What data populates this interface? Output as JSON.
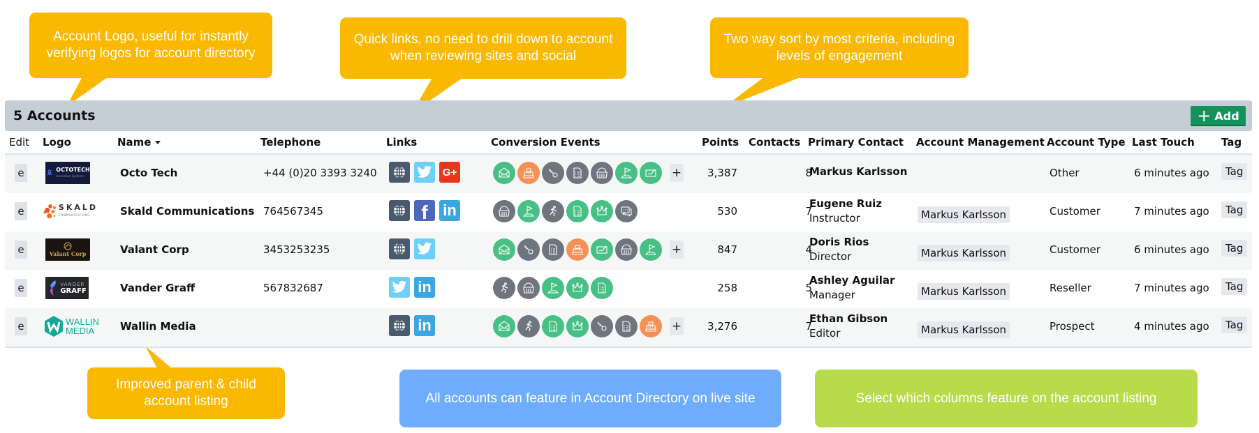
{
  "callouts": {
    "logo": "Account Logo, useful for instantly verifying logos for account directory",
    "links": "Quick links, no need to drill down to account when reviewing sites and social",
    "sort": "Two way sort by most criteria, including levels of engagement",
    "parent_child": "Improved parent & child account listing",
    "directory": "All accounts can feature in Account Directory on live site",
    "columns": "Select which columns feature on the account listing"
  },
  "colors": {
    "callout_yellow": "#fbb800",
    "callout_blue": "#6fadfc",
    "callout_green": "#b8db4a",
    "add_button": "#13935a",
    "event_green": "#47bf85",
    "event_grey": "#6f757e",
    "event_orange": "#f59057"
  },
  "list": {
    "title": "5 Accounts",
    "add_label": "Add"
  },
  "columns": {
    "edit": "Edit",
    "logo": "Logo",
    "name": "Name",
    "telephone": "Telephone",
    "links": "Links",
    "conversion_events": "Conversion Events",
    "points": "Points",
    "contacts": "Contacts",
    "primary_contact": "Primary Contact",
    "account_management": "Account Management",
    "account_type": "Account Type",
    "last_touch": "Last Touch",
    "tag": "Tag"
  },
  "sort": {
    "column": "Name",
    "direction": "descending-caret"
  },
  "rows": [
    {
      "edit_label": "e",
      "logo": "octotech-logo",
      "logo_text": "OCTOTECH",
      "logo_subtext": "Innovation Systems",
      "name": "Octo Tech",
      "telephone": "+44 (0)20 3393 3240",
      "links": [
        "globe-icon",
        "twitter-icon",
        "google-plus-icon"
      ],
      "events": [
        {
          "icon": "envelope-open-icon",
          "color": "green"
        },
        {
          "icon": "cash-register-icon",
          "color": "orange"
        },
        {
          "icon": "key-icon",
          "color": "grey"
        },
        {
          "icon": "document-checklist-icon",
          "color": "grey"
        },
        {
          "icon": "basket-icon",
          "color": "grey"
        },
        {
          "icon": "flag-icon",
          "color": "green"
        },
        {
          "icon": "signature-icon",
          "color": "green"
        }
      ],
      "has_more_events": true,
      "points": "3,387",
      "contacts": "8",
      "primary_contact": {
        "name": "Markus Karlsson",
        "title": ""
      },
      "account_manager": "",
      "account_type": "Other",
      "last_touch": "6 minutes ago",
      "tag_label": "Tag"
    },
    {
      "edit_label": "e",
      "logo": "skald-logo",
      "logo_text": "SKALD",
      "logo_subtext": "COMMUNICATIONS",
      "name": "Skald Communications",
      "telephone": "764567345",
      "links": [
        "globe-icon",
        "facebook-icon",
        "linkedin-icon"
      ],
      "events": [
        {
          "icon": "basket-icon",
          "color": "grey"
        },
        {
          "icon": "flag-icon",
          "color": "green"
        },
        {
          "icon": "running-person-icon",
          "color": "grey"
        },
        {
          "icon": "document-checklist-icon",
          "color": "green"
        },
        {
          "icon": "crown-icon",
          "color": "green"
        },
        {
          "icon": "chat-bubbles-icon",
          "color": "grey"
        }
      ],
      "has_more_events": false,
      "points": "530",
      "contacts": "7",
      "primary_contact": {
        "name": "Eugene Ruiz",
        "title": "Instructor"
      },
      "account_manager": "Markus Karlsson",
      "account_type": "Customer",
      "last_touch": "7 minutes ago",
      "tag_label": "Tag"
    },
    {
      "edit_label": "e",
      "logo": "valant-logo",
      "logo_text": "Valant Corp",
      "logo_subtext": "",
      "name": "Valant Corp",
      "telephone": "3453253235",
      "links": [
        "globe-icon",
        "twitter-icon"
      ],
      "events": [
        {
          "icon": "envelope-open-icon",
          "color": "green"
        },
        {
          "icon": "key-icon",
          "color": "grey"
        },
        {
          "icon": "document-checklist-icon",
          "color": "grey"
        },
        {
          "icon": "cash-register-icon",
          "color": "orange"
        },
        {
          "icon": "signature-icon",
          "color": "green"
        },
        {
          "icon": "basket-icon",
          "color": "grey"
        },
        {
          "icon": "flag-icon",
          "color": "green"
        }
      ],
      "has_more_events": true,
      "points": "847",
      "contacts": "4",
      "primary_contact": {
        "name": "Doris Rios",
        "title": "Director"
      },
      "account_manager": "Markus Karlsson",
      "account_type": "Customer",
      "last_touch": "6 minutes ago",
      "tag_label": "Tag"
    },
    {
      "edit_label": "e",
      "logo": "vander-graff-logo",
      "logo_text": "GRAFF",
      "logo_subtext": "VANDER",
      "name": "Vander Graff",
      "telephone": "567832687",
      "links": [
        "twitter-icon",
        "linkedin-icon"
      ],
      "events": [
        {
          "icon": "running-person-icon",
          "color": "grey"
        },
        {
          "icon": "basket-icon",
          "color": "grey"
        },
        {
          "icon": "flag-icon",
          "color": "green"
        },
        {
          "icon": "crown-icon",
          "color": "green"
        },
        {
          "icon": "document-checklist-icon",
          "color": "green"
        }
      ],
      "has_more_events": false,
      "points": "258",
      "contacts": "5",
      "primary_contact": {
        "name": "Ashley Aguilar",
        "title": "Manager"
      },
      "account_manager": "Markus Karlsson",
      "account_type": "Reseller",
      "last_touch": "7 minutes ago",
      "tag_label": "Tag"
    },
    {
      "edit_label": "e",
      "logo": "wallin-media-logo",
      "logo_text": "WALLIN",
      "logo_subtext": "MEDIA",
      "name": "Wallin Media",
      "telephone": "",
      "links": [
        "globe-icon",
        "linkedin-icon"
      ],
      "events": [
        {
          "icon": "envelope-open-icon",
          "color": "green"
        },
        {
          "icon": "running-person-icon",
          "color": "grey"
        },
        {
          "icon": "document-checklist-icon",
          "color": "green"
        },
        {
          "icon": "crown-icon",
          "color": "green"
        },
        {
          "icon": "key-icon",
          "color": "grey"
        },
        {
          "icon": "document-checklist-icon",
          "color": "grey"
        },
        {
          "icon": "cash-register-icon",
          "color": "orange"
        }
      ],
      "has_more_events": true,
      "points": "3,276",
      "contacts": "7",
      "primary_contact": {
        "name": "Ethan Gibson",
        "title": "Editor"
      },
      "account_manager": "Markus Karlsson",
      "account_type": "Prospect",
      "last_touch": "4 minutes ago",
      "tag_label": "Tag"
    }
  ]
}
